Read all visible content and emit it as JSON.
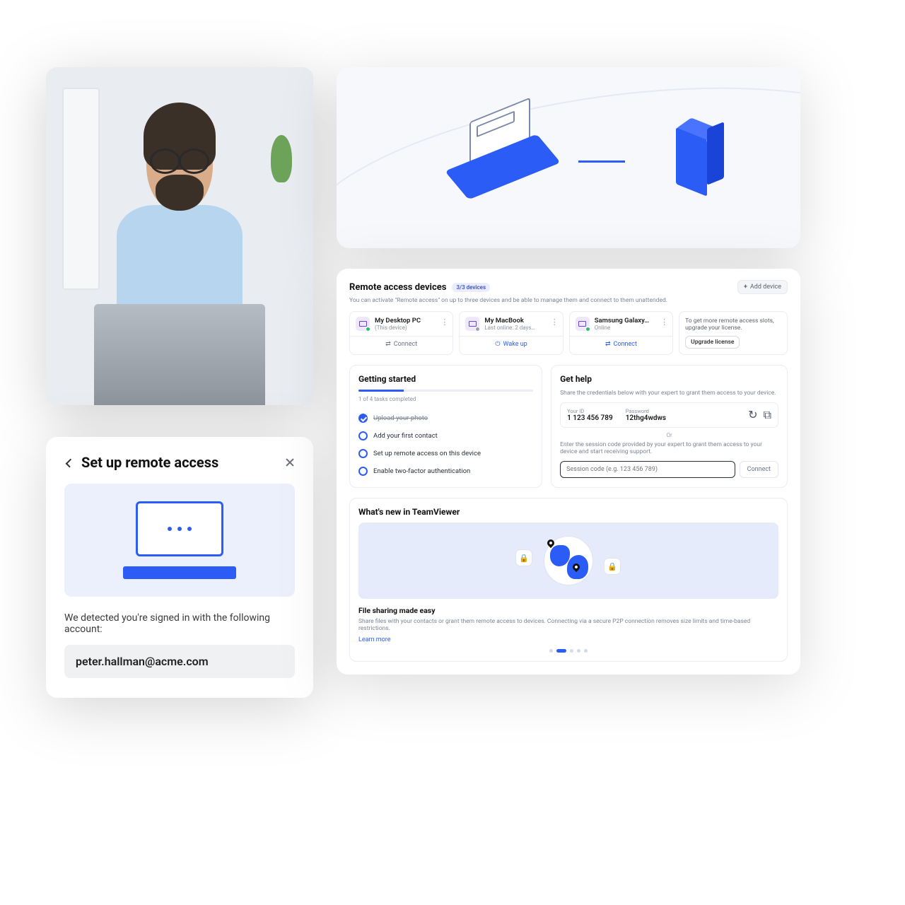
{
  "setup_modal": {
    "title": "Set up remote access",
    "detected_text": "We detected you're signed in with the following account:",
    "email": "peter.hallman@acme.com"
  },
  "devices": {
    "heading": "Remote access devices",
    "badge": "3/3 devices",
    "subtitle": "You can activate \"Remote access\" on up to three devices and be able to manage them and connect to them unattended.",
    "add_label": "Add device",
    "items": [
      {
        "name": "My Desktop PC",
        "status": "(This device)",
        "action": "Connect",
        "online": true
      },
      {
        "name": "My MacBook",
        "status": "Last online: 2 days…",
        "action": "Wake up",
        "online": false
      },
      {
        "name": "Samsung Galaxy…",
        "status": "Online",
        "action": "Connect",
        "online": true
      }
    ],
    "upsell": {
      "text": "To get more remote access slots, upgrade your license.",
      "button": "Upgrade license"
    }
  },
  "getting_started": {
    "title": "Getting started",
    "progress_label": "1 of 4 tasks completed",
    "tasks": [
      {
        "label": "Upload your photo",
        "done": true
      },
      {
        "label": "Add your first contact",
        "done": false
      },
      {
        "label": "Set up remote access on this device",
        "done": false
      },
      {
        "label": "Enable two-factor authentication",
        "done": false
      }
    ]
  },
  "get_help": {
    "title": "Get help",
    "share_text": "Share the credentials below with your expert to grant them access to your device.",
    "id_label": "Your ID",
    "id_value": "1 123 456 789",
    "pw_label": "Password",
    "pw_value": "12thg4wdws",
    "or": "Or",
    "enter_text": "Enter the session code provided by your expert to grant them access to your device and start receiving support.",
    "placeholder": "Session code (e.g. 123 456 789)",
    "connect": "Connect"
  },
  "whats_new": {
    "heading": "What's new in TeamViewer",
    "title": "File sharing made easy",
    "desc": "Share files with your contacts or grant them remote access to devices. Connecting via a secure P2P connection removes size limits and time-based restrictions.",
    "learn_more": "Learn more"
  }
}
